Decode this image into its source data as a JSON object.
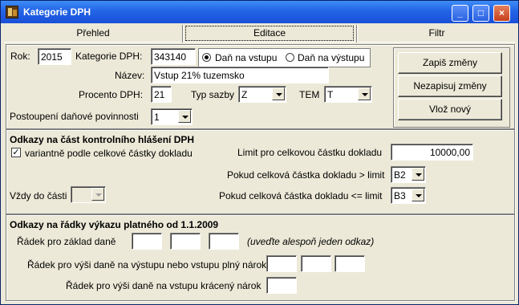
{
  "window": {
    "title": "Kategorie DPH",
    "min_glyph": "_",
    "max_glyph": "□",
    "close_glyph": "×"
  },
  "tabs": [
    {
      "label": "Přehled"
    },
    {
      "label": "Editace"
    },
    {
      "label": "Filtr"
    }
  ],
  "form": {
    "rok_label": "Rok:",
    "rok_value": "2015",
    "kategorie_label": "Kategorie DPH:",
    "kategorie_value": "343140",
    "radio_vstup": "Daň na vstupu",
    "radio_vystup": "Daň na výstupu",
    "nazev_label": "Název:",
    "nazev_value": "Vstup 21% tuzemsko",
    "procento_label": "Procento DPH:",
    "procento_value": "21",
    "typ_sazby_label": "Typ sazby",
    "typ_sazby_value": "Z",
    "tem_label": "TEM",
    "tem_value": "T",
    "postoupeni_label": "Postoupení daňové povinnosti",
    "postoupeni_value": "1"
  },
  "buttons": {
    "save": "Zapiš změny",
    "discard": "Nezapisuj změny",
    "insert": "Vlož nový"
  },
  "kontrolni": {
    "heading": "Odkazy na část kontrolního hlášení DPH",
    "checkbox_label": "variantně podle celkové částky dokladu",
    "checkbox_mark": "✓",
    "limit_label": "Limit pro celkovou částku dokladu",
    "limit_value": "10000,00",
    "greater_label": "Pokud celková částka dokladu > limit",
    "greater_value": "B2",
    "less_label": "Pokud celková částka dokladu <= limit",
    "less_value": "B3",
    "vzdy_label": "Vždy do části",
    "vzdy_value": ""
  },
  "vykaz": {
    "heading": "Odkazy na řádky výkazu platného od 1.1.2009",
    "zaklad_label": "Řádek pro základ daně",
    "hint": "(uveďte alespoň jeden odkaz)",
    "plny_label": "Řádek pro výši daně na výstupu nebo vstupu plný nárok",
    "kraceny_label": "Řádek pro výši daně na vstupu krácený nárok"
  }
}
